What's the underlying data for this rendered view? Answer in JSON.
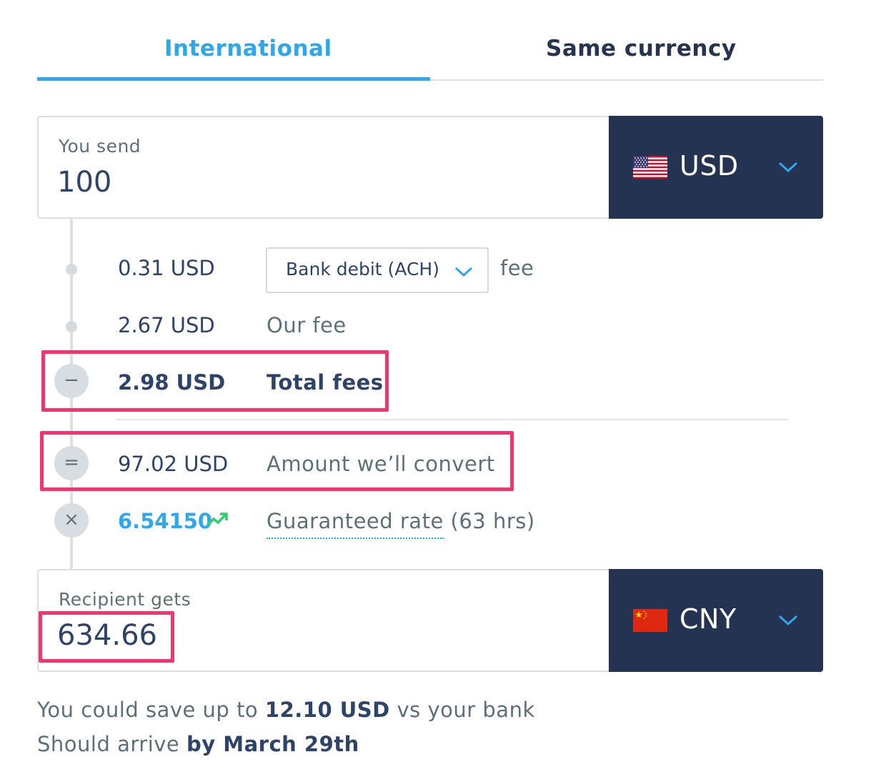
{
  "tabs": [
    {
      "label": "International",
      "active": true
    },
    {
      "label": "Same currency",
      "active": false
    }
  ],
  "send": {
    "label": "You send",
    "amount": "100",
    "currency": "USD",
    "flag_icon": "us-flag-icon"
  },
  "breakdown": {
    "payment_fee_amount": "0.31 USD",
    "payment_method": "Bank debit (ACH)",
    "payment_fee_suffix": "fee",
    "our_fee_amount": "2.67 USD",
    "our_fee_label": "Our fee",
    "total_fees_amount": "2.98 USD",
    "total_fees_label": "Total fees",
    "total_fees_symbol": "−",
    "convert_amount": "97.02 USD",
    "convert_label": "Amount we’ll convert",
    "convert_symbol": "=",
    "rate_value": "6.54150",
    "rate_symbol": "×",
    "rate_label": "Guaranteed rate",
    "rate_duration": " (63 hrs)",
    "rate_trend_icon": "trending-up-icon"
  },
  "receive": {
    "label": "Recipient gets",
    "amount": "634.66",
    "currency": "CNY",
    "flag_icon": "china-flag-icon"
  },
  "footer": {
    "save_prefix": "You could save up to ",
    "save_amount": "12.10 USD",
    "save_suffix": " vs your bank",
    "arrive_prefix": "Should arrive ",
    "arrive_date": "by March 29th"
  },
  "colors": {
    "accent": "#2ea7ee",
    "navy": "#253352",
    "highlight": "#f2356e",
    "trend_green": "#2ed06e"
  }
}
